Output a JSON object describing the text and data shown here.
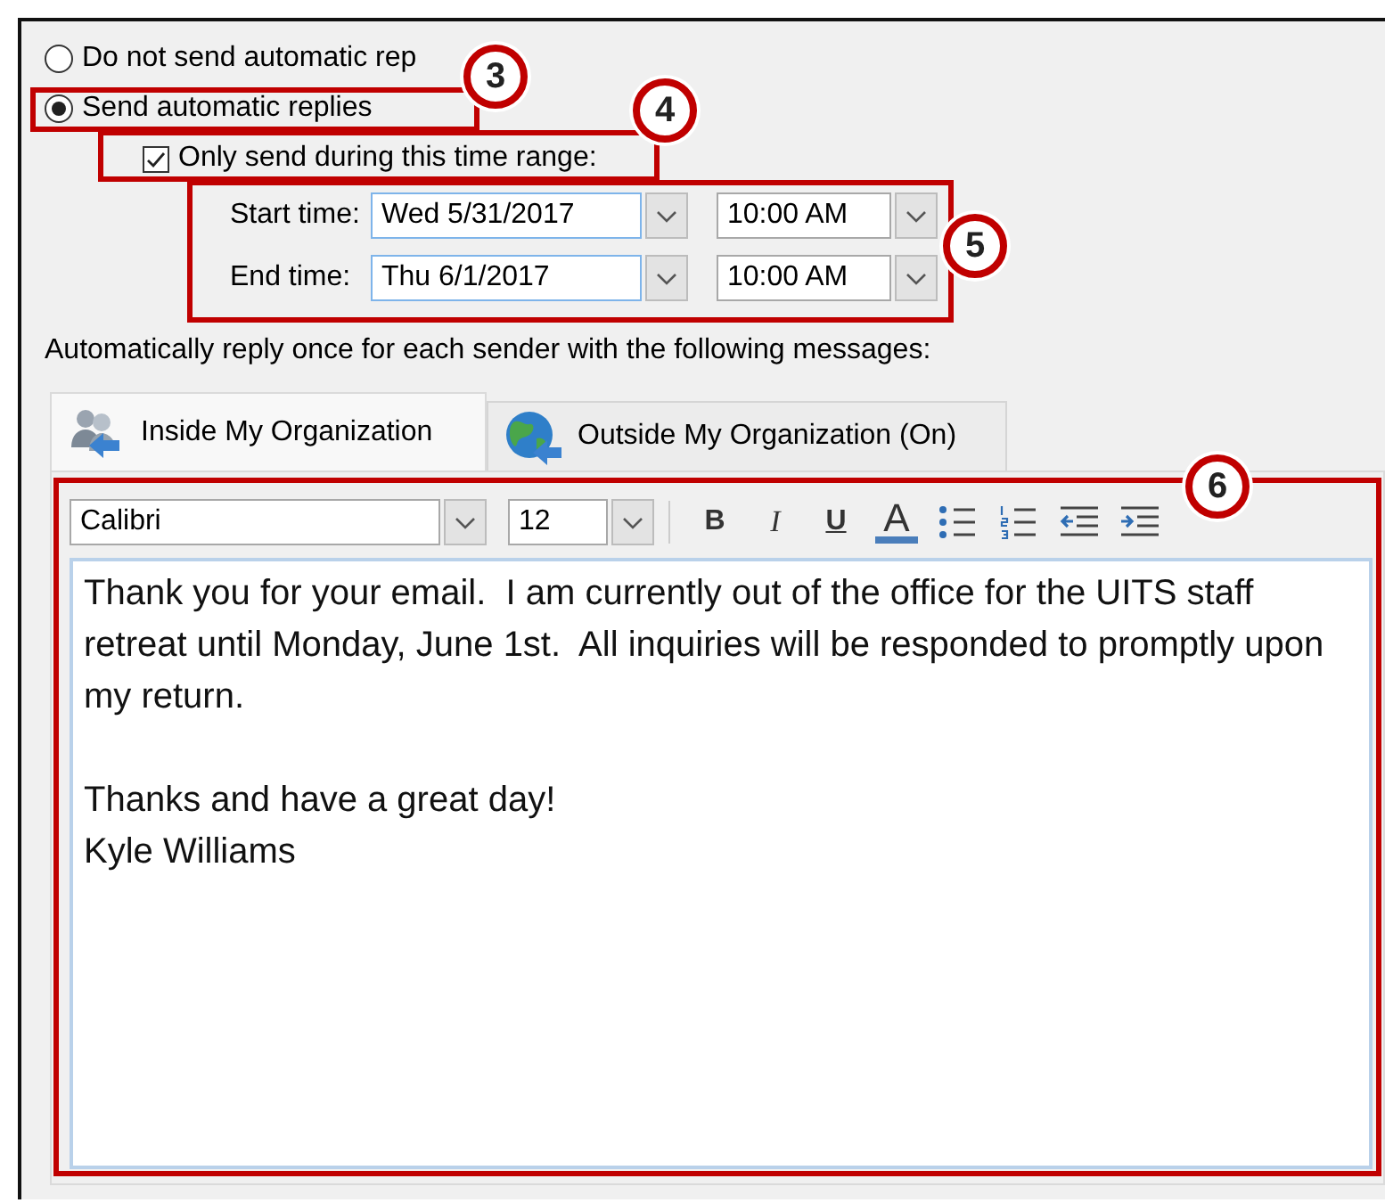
{
  "options": [
    {
      "label": "Do not send automatic rep",
      "selected": false
    },
    {
      "label": "Send automatic replies",
      "selected": true
    }
  ],
  "time_range": {
    "label": "Only send during this time range:",
    "checked": true
  },
  "times": [
    {
      "label": "Start time:",
      "date": "Wed 5/31/2017",
      "time": "10:00 AM"
    },
    {
      "label": "End time:",
      "date": "Thu 6/1/2017",
      "time": "10:00 AM"
    }
  ],
  "instruction": "Automatically reply once for each sender with the following messages:",
  "tabs": [
    {
      "label": "Inside My Organization",
      "selected": true,
      "kind": "people"
    },
    {
      "label": "Outside My Organization (On)",
      "selected": false,
      "kind": "globe"
    }
  ],
  "toolbar": {
    "font": "Calibri",
    "size": "12",
    "buttons": [
      {
        "kind": "bold",
        "label": "B"
      },
      {
        "kind": "italic",
        "label": "I"
      },
      {
        "kind": "underline",
        "label": "U"
      },
      {
        "kind": "color",
        "label": "A"
      },
      {
        "kind": "bullets"
      },
      {
        "kind": "numbering"
      },
      {
        "kind": "outdent"
      },
      {
        "kind": "indent"
      }
    ]
  },
  "message": [
    [
      "Thank you for your email.  I am currently out of the office for the UITS staff retreat until Monday, June 1st.  All inquiries will be responded to promptly upon my return."
    ],
    [
      "Thanks and have a great day!",
      "Kyle Williams"
    ]
  ],
  "annotations": [
    {
      "number": "3"
    },
    {
      "number": "4"
    },
    {
      "number": "5"
    },
    {
      "number": "6"
    }
  ]
}
